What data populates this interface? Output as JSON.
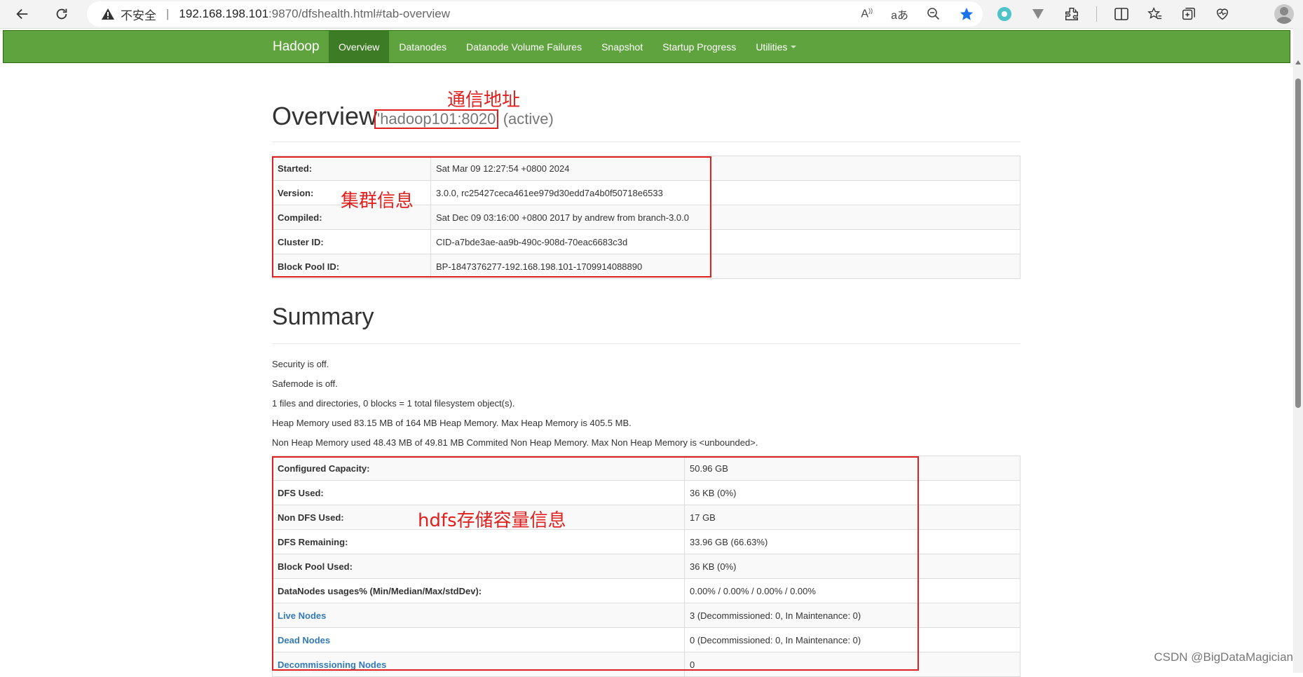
{
  "browser": {
    "address_warning": "不安全",
    "address_host": "192.168.198.101",
    "address_path": ":9870/dfshealth.html#tab-overview",
    "read_aloud": "A",
    "translate": "aあ"
  },
  "navbar": {
    "brand": "Hadoop",
    "items": [
      {
        "label": "Overview",
        "active": true
      },
      {
        "label": "Datanodes"
      },
      {
        "label": "Datanode Volume Failures"
      },
      {
        "label": "Snapshot"
      },
      {
        "label": "Startup Progress"
      },
      {
        "label": "Utilities"
      }
    ],
    "color": "#5fa33e",
    "active_color": "#3d7b24"
  },
  "overview": {
    "title": "Overview",
    "address": "'hadoop101:8020'",
    "status": "(active)",
    "annotation_address": "通信地址",
    "annotation_cluster": "集群信息",
    "rows": [
      {
        "key": "Started:",
        "value": "Sat Mar 09 12:27:54 +0800 2024"
      },
      {
        "key": "Version:",
        "value": "3.0.0, rc25427ceca461ee979d30edd7a4b0f50718e6533"
      },
      {
        "key": "Compiled:",
        "value": "Sat Dec 09 03:16:00 +0800 2017 by andrew from branch-3.0.0"
      },
      {
        "key": "Cluster ID:",
        "value": "CID-a7bde3ae-aa9b-490c-908d-70eac6683c3d"
      },
      {
        "key": "Block Pool ID:",
        "value": "BP-1847376277-192.168.198.101-1709914088890"
      }
    ]
  },
  "summary": {
    "title": "Summary",
    "lines": [
      "Security is off.",
      "Safemode is off.",
      "1 files and directories, 0 blocks = 1 total filesystem object(s).",
      "Heap Memory used 83.15 MB of 164 MB Heap Memory. Max Heap Memory is 405.5 MB.",
      "Non Heap Memory used 48.43 MB of 49.81 MB Commited Non Heap Memory. Max Non Heap Memory is <unbounded>."
    ],
    "annotation_storage": "hdfs存储容量信息",
    "rows": [
      {
        "key": "Configured Capacity:",
        "value": "50.96 GB"
      },
      {
        "key": "DFS Used:",
        "value": "36 KB (0%)"
      },
      {
        "key": "Non DFS Used:",
        "value": "17 GB"
      },
      {
        "key": "DFS Remaining:",
        "value": "33.96 GB (66.63%)"
      },
      {
        "key": "Block Pool Used:",
        "value": "36 KB (0%)"
      },
      {
        "key": "DataNodes usages% (Min/Median/Max/stdDev):",
        "value": "0.00% / 0.00% / 0.00% / 0.00%"
      },
      {
        "key": "Live Nodes",
        "value": "3 (Decommissioned: 0, In Maintenance: 0)",
        "link": true
      },
      {
        "key": "Dead Nodes",
        "value": "0 (Decommissioned: 0, In Maintenance: 0)",
        "link": true
      },
      {
        "key": "Decommissioning Nodes",
        "value": "0",
        "link": true
      }
    ]
  },
  "watermark": "CSDN @BigDataMagician",
  "colors": {
    "annotation": "#e0201e",
    "link": "#337ab7"
  }
}
